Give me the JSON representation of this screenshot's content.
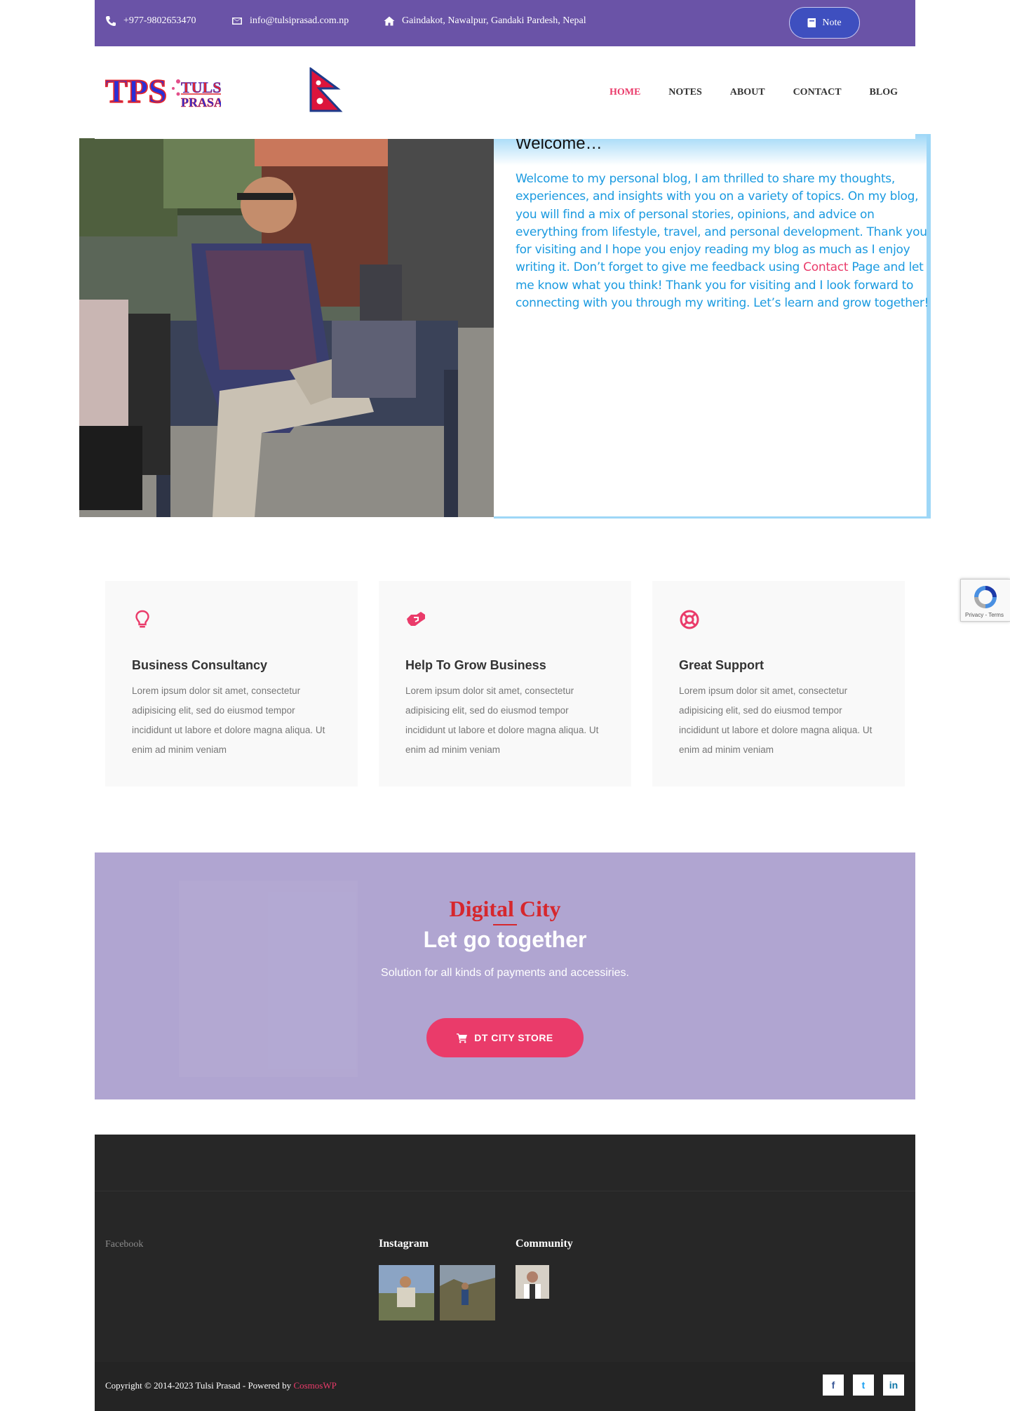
{
  "topbar": {
    "phone": "+977-9802653470",
    "email": "info@tulsiprasad.com.np",
    "address": "Gaindakot, Nawalpur, Gandaki Pardesh, Nepal",
    "note_label": "Note",
    "bg_color": "#6a53a7"
  },
  "header": {
    "logo_letters": "TPS",
    "logo_name_top": "TULSI",
    "logo_name_bottom": "PRASAD",
    "nav": [
      {
        "label": "HOME",
        "active": true
      },
      {
        "label": "NOTES",
        "active": false
      },
      {
        "label": "ABOUT",
        "active": false
      },
      {
        "label": "CONTACT",
        "active": false
      },
      {
        "label": "BLOG",
        "active": false
      }
    ],
    "accent_color": "#ea3b6a"
  },
  "welcome": {
    "heading": "Welcome…",
    "text_before": "Welcome to my personal blog, I am thrilled to share my thoughts, experiences, and insights with you on a variety of topics. On my blog, you will find a mix of personal stories, opinions, and advice on everything from lifestyle, travel, and personal development. Thank you for visiting and I hope you enjoy reading my blog as much as I enjoy writing it. Don’t forget to give me feedback using ",
    "link_text": "Contact",
    "text_after": " Page and let me know what you think! Thank you for visiting and I look forward to connecting with you through my writing. Let’s learn and grow together!",
    "text_color": "#1a9ae0"
  },
  "features": [
    {
      "icon": "lightbulb-icon",
      "title": "Business Consultancy",
      "text": "Lorem ipsum dolor sit amet, consectetur adipisicing elit, sed do eiusmod tempor incididunt ut labore et dolore magna aliqua. Ut enim ad minim veniam"
    },
    {
      "icon": "handshake-icon",
      "title": "Help To Grow Business",
      "text": "Lorem ipsum dolor sit amet, consectetur adipisicing elit, sed do eiusmod tempor incididunt ut labore et dolore magna aliqua. Ut enim ad minim veniam"
    },
    {
      "icon": "life-ring-icon",
      "title": "Great Support",
      "text": "Lorem ipsum dolor sit amet, consectetur adipisicing elit, sed do eiusmod tempor incididunt ut labore et dolore magna aliqua. Ut enim ad minim veniam"
    }
  ],
  "cta": {
    "subtitle": "Digital City",
    "title": "Let go together",
    "description": "Solution for all kinds of payments and accessiries.",
    "button_label": "DT CITY STORE",
    "bg_color": "#b0a5d1"
  },
  "footer": {
    "facebook_label": "Facebook",
    "instagram_heading": "Instagram",
    "community_heading": "Community",
    "copyright": "Copyright © 2014-2023 Tulsi Prasad - Powered by ",
    "powered_by": "CosmosWP",
    "social": [
      "f",
      "t",
      "in"
    ]
  },
  "recaptcha": {
    "label": "Privacy - Terms"
  }
}
